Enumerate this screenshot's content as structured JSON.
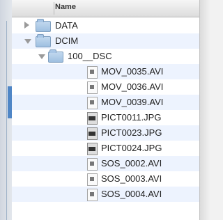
{
  "header": {
    "name_label": "Name"
  },
  "rows": [
    {
      "label": "DATA",
      "kind": "folder",
      "expanded": false
    },
    {
      "label": "DCIM",
      "kind": "folder",
      "expanded": true
    },
    {
      "label": "100__DSC",
      "kind": "folder",
      "expanded": true
    },
    {
      "label": "MOV_0035.AVI",
      "kind": "movie"
    },
    {
      "label": "MOV_0036.AVI",
      "kind": "movie"
    },
    {
      "label": "MOV_0039.AVI",
      "kind": "movie"
    },
    {
      "label": "PICT0011.JPG",
      "kind": "photo"
    },
    {
      "label": "PICT0023.JPG",
      "kind": "photo"
    },
    {
      "label": "PICT0024.JPG",
      "kind": "photo"
    },
    {
      "label": "SOS_0002.AVI",
      "kind": "movie"
    },
    {
      "label": "SOS_0003.AVI",
      "kind": "movie"
    },
    {
      "label": "SOS_0004.AVI",
      "kind": "movie"
    }
  ]
}
